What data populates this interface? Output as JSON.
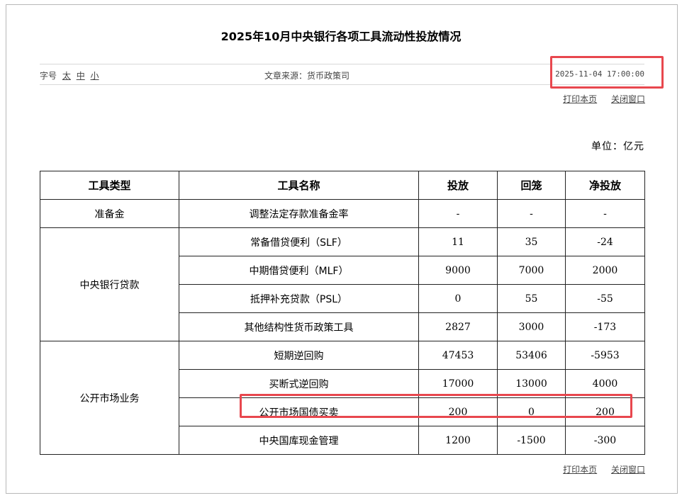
{
  "page": {
    "title": "2025年10月中央银行各项工具流动性投放情况",
    "font_size_label": "字号",
    "font_size_options": [
      "太",
      "中",
      "小"
    ],
    "source": "文章来源：货币政策司",
    "date": "2025-11-04 17:00:00",
    "print_link": "打印本页",
    "close_link": "关闭窗口",
    "unit": "单位：亿元"
  },
  "table": {
    "headers": [
      "工具类型",
      "工具名称",
      "投放",
      "回笼",
      "净投放"
    ],
    "groups": [
      {
        "category": "准备金",
        "rows": [
          {
            "name": "调整法定存款准备金率",
            "inject": "-",
            "withdraw": "-",
            "net": "-"
          }
        ]
      },
      {
        "category": "中央银行贷款",
        "rows": [
          {
            "name": "常备借贷便利（SLF）",
            "inject": "11",
            "withdraw": "35",
            "net": "-24"
          },
          {
            "name": "中期借贷便利（MLF）",
            "inject": "9000",
            "withdraw": "7000",
            "net": "2000"
          },
          {
            "name": "抵押补充贷款（PSL）",
            "inject": "0",
            "withdraw": "55",
            "net": "-55"
          },
          {
            "name": "其他结构性货币政策工具",
            "inject": "2827",
            "withdraw": "3000",
            "net": "-173"
          }
        ]
      },
      {
        "category": "公开市场业务",
        "rows": [
          {
            "name": "短期逆回购",
            "inject": "47453",
            "withdraw": "53406",
            "net": "-5953"
          },
          {
            "name": "买断式逆回购",
            "inject": "17000",
            "withdraw": "13000",
            "net": "4000"
          },
          {
            "name": "公开市场国债买卖",
            "inject": "200",
            "withdraw": "0",
            "net": "200"
          },
          {
            "name": "中央国库现金管理",
            "inject": "1200",
            "withdraw": "-1500",
            "net": "-300"
          }
        ]
      }
    ]
  },
  "annotations": {
    "highlight_color": "#e8474e"
  }
}
